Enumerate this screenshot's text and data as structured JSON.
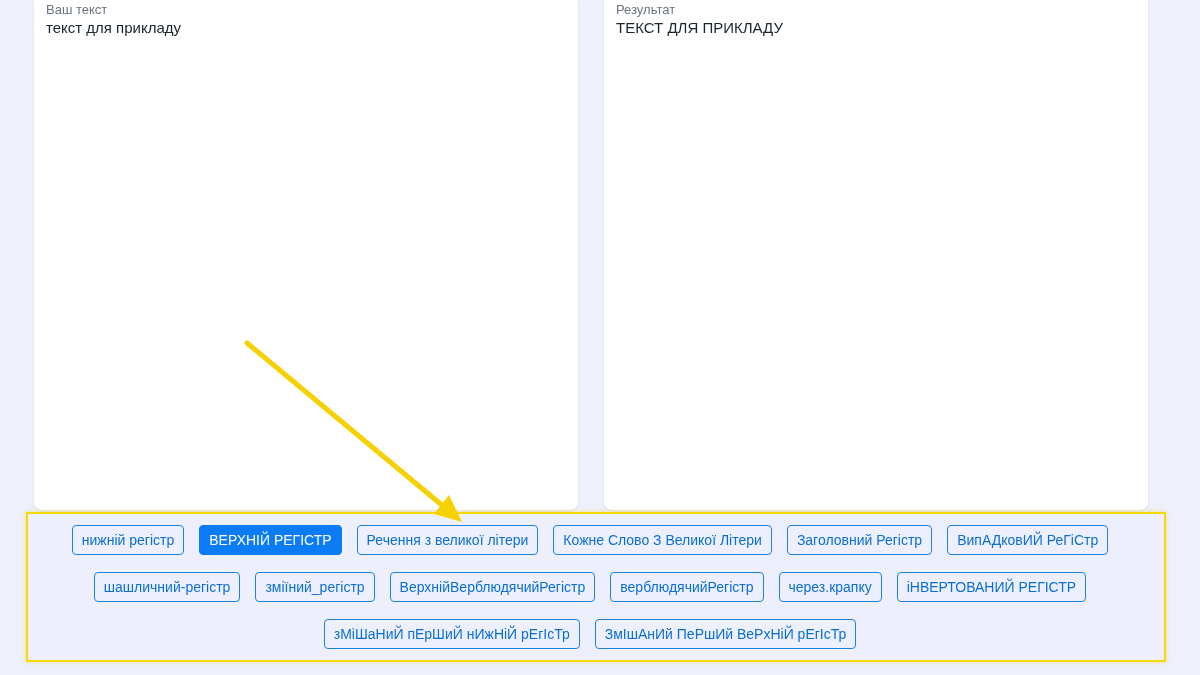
{
  "input": {
    "label": "Ваш текст",
    "value": "текст для прикладу"
  },
  "result": {
    "label": "Результат",
    "value": "ТЕКСТ ДЛЯ ПРИКЛАДУ"
  },
  "options": {
    "highlighted": true,
    "buttons": [
      {
        "label": "нижній регістр",
        "selected": false
      },
      {
        "label": "ВЕРХНІЙ РЕГІСТР",
        "selected": true
      },
      {
        "label": "Речення з великої літери",
        "selected": false
      },
      {
        "label": "Кожне Слово З Великої Літери",
        "selected": false
      },
      {
        "label": "Заголовний Регістр",
        "selected": false
      },
      {
        "label": "ВипАДковИЙ РеГіСтр",
        "selected": false
      },
      {
        "label": "шашличний-регістр",
        "selected": false
      },
      {
        "label": "зміїний_регістр",
        "selected": false
      },
      {
        "label": "ВерхнійВерблюдячийРегістр",
        "selected": false
      },
      {
        "label": "верблюдячийРегістр",
        "selected": false
      },
      {
        "label": "через.крапку",
        "selected": false
      },
      {
        "label": "іНВЕРТОВАНИЙ РЕГІСТР",
        "selected": false
      },
      {
        "label": "зМіШаНиЙ пЕрШиЙ нИжНіЙ рЕгІсТр",
        "selected": false
      },
      {
        "label": "ЗмІшАнИй ПеРшИй ВеРхНіЙ рЕгІсТр",
        "selected": false
      }
    ]
  },
  "annotation": {
    "kind": "arrow"
  }
}
